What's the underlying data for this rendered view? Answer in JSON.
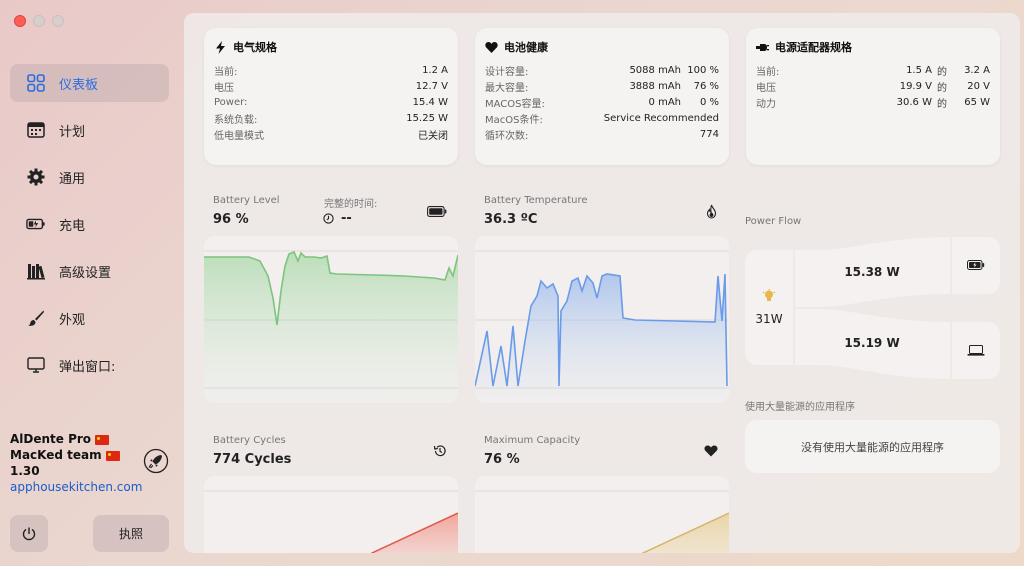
{
  "sidebar": {
    "items": [
      {
        "label": "仪表板",
        "icon": "dashboard-grid-icon"
      },
      {
        "label": "计划",
        "icon": "calendar-icon"
      },
      {
        "label": "通用",
        "icon": "gear-icon"
      },
      {
        "label": "充电",
        "icon": "battery-charging-icon"
      },
      {
        "label": "高级设置",
        "icon": "books-icon"
      },
      {
        "label": "外观",
        "icon": "paintbrush-icon"
      },
      {
        "label": "弹出窗口:",
        "icon": "monitor-icon"
      }
    ],
    "brand_line1": "AlDente Pro",
    "brand_line2": "MacKed team",
    "version": "1.30",
    "link": "apphousekitchen.com",
    "license_label": "执照"
  },
  "electrical": {
    "title": "电气规格",
    "rows": [
      {
        "label": "当前:",
        "value": "1.2 A"
      },
      {
        "label": "电压",
        "value": "12.7 V"
      },
      {
        "label": "Power:",
        "value": "15.4 W"
      },
      {
        "label": "系统负载:",
        "value": "15.25 W"
      },
      {
        "label": "低电量模式",
        "value": "已关闭"
      }
    ]
  },
  "battery_health": {
    "title": "电池健康",
    "rows": [
      {
        "label": "设计容量:",
        "value": "5088 mAh",
        "extra": "100 %"
      },
      {
        "label": "最大容量:",
        "value": "3888 mAh",
        "extra": "76 %"
      },
      {
        "label": "MACOS容量:",
        "value": "0 mAh",
        "extra": "0 %"
      },
      {
        "label": "MacOS条件:",
        "value": "Service Recommended",
        "extra": ""
      },
      {
        "label": "循环次数:",
        "value": "774",
        "extra": ""
      }
    ]
  },
  "adapter": {
    "title": "电源适配器规格",
    "rows": [
      {
        "label": "当前:",
        "value": "1.5 A",
        "of": "的",
        "max": "3.2 A"
      },
      {
        "label": "电压",
        "value": "19.9 V",
        "of": "的",
        "max": "20 V"
      },
      {
        "label": "动力",
        "value": "30.6 W",
        "of": "的",
        "max": "65 W"
      }
    ]
  },
  "battery_level": {
    "label": "Battery Level",
    "value": "96 %",
    "time_label": "完整的时间:",
    "time_value": "--"
  },
  "battery_temp": {
    "label": "Battery Temperature",
    "value": "36.3 ºC"
  },
  "battery_cycles": {
    "label": "Battery Cycles",
    "value": "774 Cycles"
  },
  "max_capacity": {
    "label": "Maximum Capacity",
    "value": "76 %"
  },
  "power_flow": {
    "label": "Power Flow",
    "input": "31W",
    "to_battery": "15.38 W",
    "to_system": "15.19 W"
  },
  "apps": {
    "label": "使用大量能源的应用程序",
    "empty": "没有使用大量能源的应用程序"
  },
  "colors": {
    "accent": "#2a6ce0",
    "level_line": "#7dc47d",
    "temp_line": "#6a9be8",
    "cycles_line": "#e0564a",
    "capacity_line": "#d8b46a"
  }
}
